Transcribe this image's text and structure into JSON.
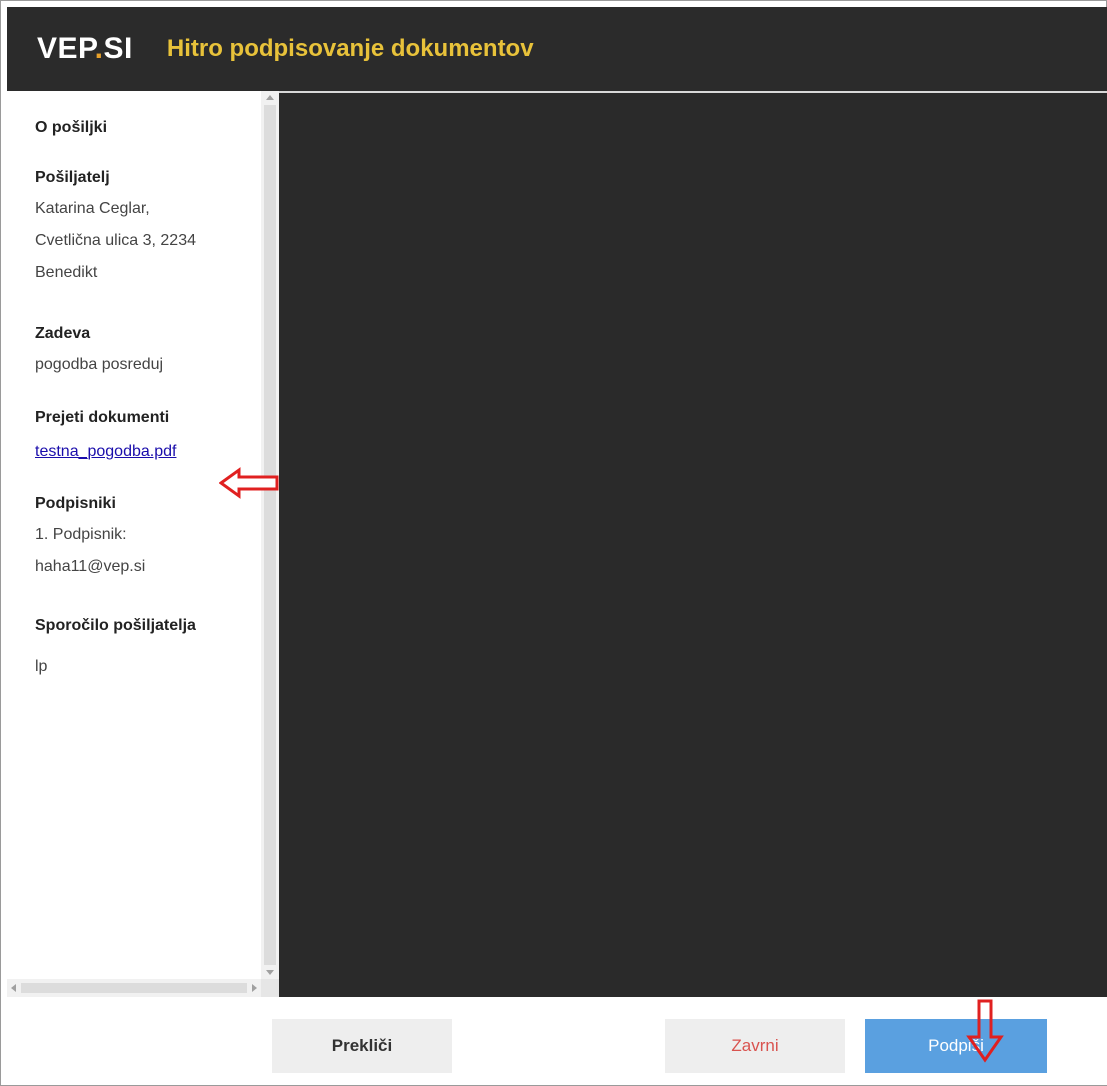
{
  "header": {
    "logo_main": "VEP",
    "logo_dot": ".",
    "logo_suffix": "SI",
    "title": "Hitro podpisovanje dokumentov"
  },
  "sidebar": {
    "heading": "O pošiljki",
    "sender": {
      "label": "Pošiljatelj",
      "lines": [
        "Katarina Ceglar,",
        "Cvetlična ulica 3, 2234",
        "Benedikt"
      ]
    },
    "subject": {
      "label": "Zadeva",
      "value": "pogodba posreduj"
    },
    "documents": {
      "label": "Prejeti dokumenti",
      "items": [
        "testna_pogodba.pdf"
      ]
    },
    "signers": {
      "label": "Podpisniki",
      "lines": [
        "1. Podpisnik:",
        "haha11@vep.si"
      ]
    },
    "message": {
      "label": "Sporočilo pošiljatelja",
      "value": "lp"
    }
  },
  "footer": {
    "cancel_label": "Prekliči",
    "finish_label": "Zavrni",
    "sign_label": "Podpiši"
  },
  "colors": {
    "header_bg": "#2b2b2b",
    "title_color": "#e8c23a",
    "logo_dot": "#e8a12a",
    "viewer_bg": "#2a2a2a",
    "link": "#1a0dab",
    "reject_text": "#d9534f",
    "sign_bg": "#5aa0e0",
    "annotation_arrow": "#e02020"
  }
}
